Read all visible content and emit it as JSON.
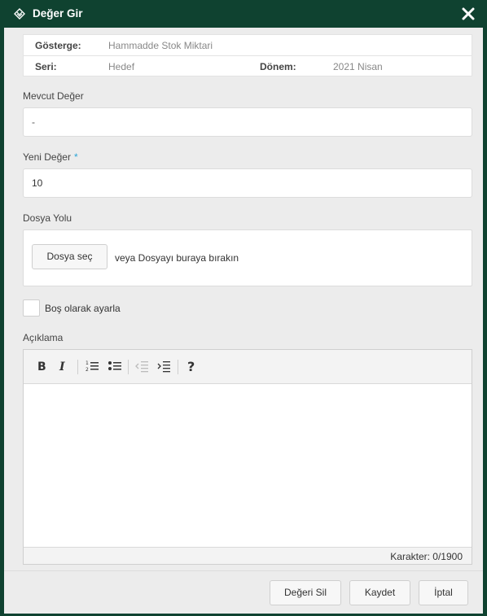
{
  "dialog": {
    "title": "Değer Gir",
    "close_icon": "close-icon",
    "title_icon": "layers-icon"
  },
  "info": {
    "indicator_label": "Gösterge:",
    "indicator_value": "Hammadde Stok Miktari",
    "series_label": "Seri:",
    "series_value": "Hedef",
    "period_label": "Dönem:",
    "period_value": "2021 Nisan"
  },
  "form": {
    "current_value_label": "Mevcut Değer",
    "current_value": "-",
    "new_value_label": "Yeni Değer",
    "new_value_required": "*",
    "new_value": "10",
    "file_path_label": "Dosya Yolu",
    "choose_file_button": "Dosya seç",
    "drop_hint": "veya Dosyayı buraya bırakın",
    "set_empty_label": "Boş olarak ayarla",
    "set_empty_checked": false,
    "description_label": "Açıklama",
    "char_counter": "Karakter: 0/1900"
  },
  "editor_toolbar": [
    "bold-icon",
    "italic-icon",
    "ordered-list-icon",
    "unordered-list-icon",
    "outdent-icon",
    "indent-icon",
    "help-icon"
  ],
  "footer": {
    "delete_value_button": "Değeri Sil",
    "save_button": "Kaydet",
    "cancel_button": "İptal"
  },
  "colors": {
    "titlebar": "#0f4230",
    "accent": "#2ba5d6",
    "panel": "#ececec"
  }
}
